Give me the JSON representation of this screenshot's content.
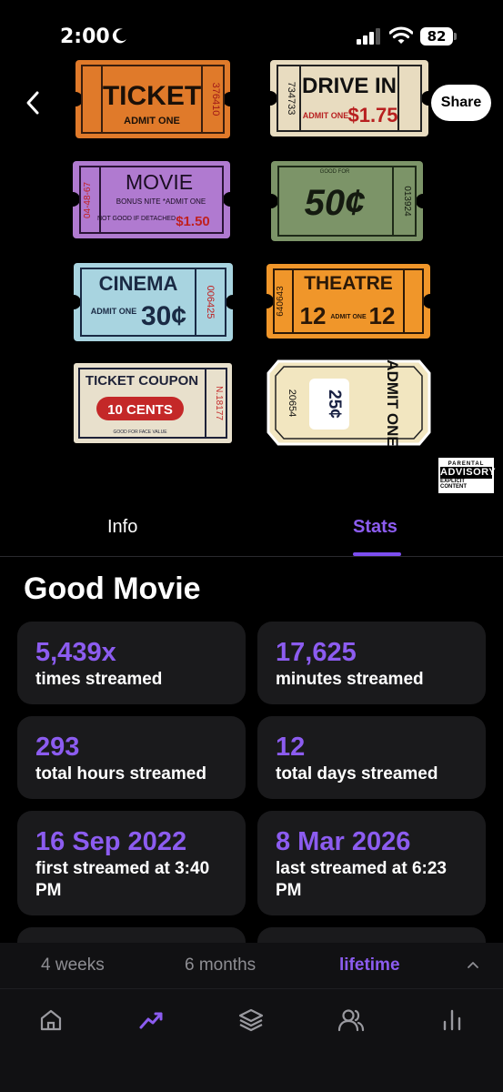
{
  "status_bar": {
    "time": "2:00",
    "battery": "82"
  },
  "header": {
    "share_label": "Share"
  },
  "album_art": {
    "tickets": [
      {
        "title": "TICKET",
        "sub": "ADMIT ONE",
        "serial": "376410",
        "color": "#e07a2a"
      },
      {
        "title": "DRIVE IN",
        "sub": "ADMIT ONE",
        "price": "$1.75",
        "serial": "734733",
        "color": "#e8dcc0"
      },
      {
        "title": "MOVIE",
        "sub": "BONUS NITE *ADMIT ONE",
        "extra": "NOT GOOD IF DETACHED",
        "price": "$1.50",
        "serial": "04-48-67",
        "color": "#b07ad0"
      },
      {
        "title": "50¢",
        "sub": "GOOD FOR",
        "serial": "013924",
        "color": "#7c9468"
      },
      {
        "title": "CINEMA",
        "sub": "ADMIT ONE",
        "price": "30¢",
        "serial": "006425",
        "color": "#a8d4e0"
      },
      {
        "title": "THEATRE",
        "sub": "ADMIT ONE",
        "price": "12",
        "serial": "640643",
        "color": "#f0962a"
      },
      {
        "title": "TICKET COUPON",
        "sub": "10 CENTS",
        "extra": "GOOD FOR FACE VALUE",
        "serial": "N.18177",
        "color": "#e8e0cc"
      },
      {
        "title": "ADMIT ONE",
        "price": "25¢",
        "serial": "20654",
        "color": "#f2e6c0"
      }
    ],
    "advisory": {
      "line1": "PARENTAL",
      "line2": "ADVISORY",
      "line3": "EXPLICIT CONTENT"
    }
  },
  "tabs": {
    "info": "Info",
    "stats": "Stats",
    "active": "stats"
  },
  "page_title": "Good Movie",
  "stats": [
    {
      "value": "5,439x",
      "label": "times streamed"
    },
    {
      "value": "17,625",
      "label": "minutes streamed"
    },
    {
      "value": "293",
      "label": "total hours streamed"
    },
    {
      "value": "12",
      "label": "total days streamed"
    },
    {
      "value": "16 Sep 2022",
      "label": "first streamed at 3:40 PM"
    },
    {
      "value": "8 Mar 2026",
      "label": "last streamed at 6:23 PM"
    }
  ],
  "range": {
    "options": [
      "4 weeks",
      "6 months",
      "lifetime"
    ],
    "selected": "lifetime"
  },
  "nav": {
    "items": [
      "home-icon",
      "trending-icon",
      "layers-icon",
      "friends-icon",
      "charts-icon"
    ],
    "active": "trending-icon"
  },
  "colors": {
    "accent": "#8c5cf0",
    "card_bg": "#1a1a1c",
    "background": "#000000"
  }
}
